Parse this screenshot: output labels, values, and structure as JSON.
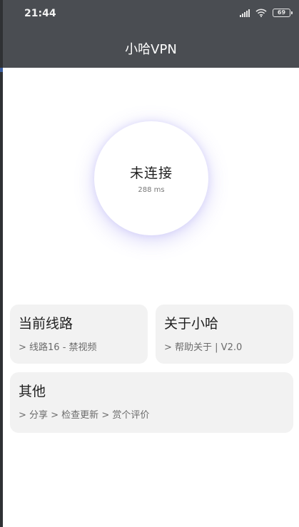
{
  "status_bar": {
    "time": "21:44",
    "battery": "69"
  },
  "app": {
    "title": "小哈VPN"
  },
  "connection": {
    "status": "未连接",
    "ping": "288 ms"
  },
  "cards": {
    "line": {
      "title": "当前线路",
      "subtitle": "> 线路16 - 禁视频"
    },
    "about": {
      "title": "关于小哈",
      "subtitle": "> 帮助关于 | V2.0"
    },
    "other": {
      "title": "其他",
      "subtitle": "> 分享 > 检查更新 > 赏个评价"
    }
  },
  "colors": {
    "header": "#4a4d52",
    "card": "#f2f2f2",
    "glow": "#6e64eb"
  }
}
